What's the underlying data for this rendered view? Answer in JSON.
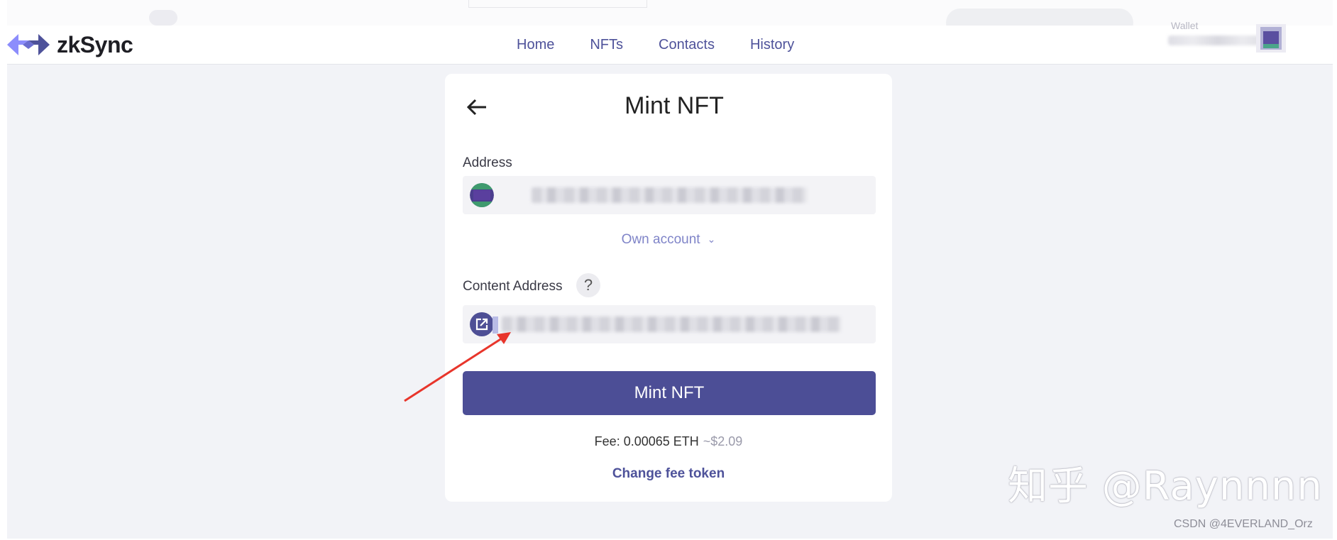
{
  "app": {
    "brand": "zkSync",
    "brand_color": "#4e529a",
    "accent_color": "#4c4e96"
  },
  "header": {
    "nav": [
      {
        "label": "Home"
      },
      {
        "label": "NFTs"
      },
      {
        "label": "Contacts"
      },
      {
        "label": "History"
      }
    ],
    "wallet_label": "Wallet"
  },
  "mint": {
    "title": "Mint NFT",
    "address_label": "Address",
    "own_account": "Own account",
    "content_address_label": "Content Address",
    "help_symbol": "?",
    "button_label": "Mint NFT",
    "fee_text": "Fee: 0.00065 ETH",
    "fee_usd": "~$2.09",
    "change_fee_label": "Change fee token"
  },
  "icons": {
    "back": "arrow-left-icon",
    "content": "external-link-icon",
    "chevron": "chevron-down-icon"
  },
  "watermarks": {
    "zhihu": "知乎 @Raynnnn",
    "csdn": "CSDN @4EVERLAND_Orz"
  }
}
